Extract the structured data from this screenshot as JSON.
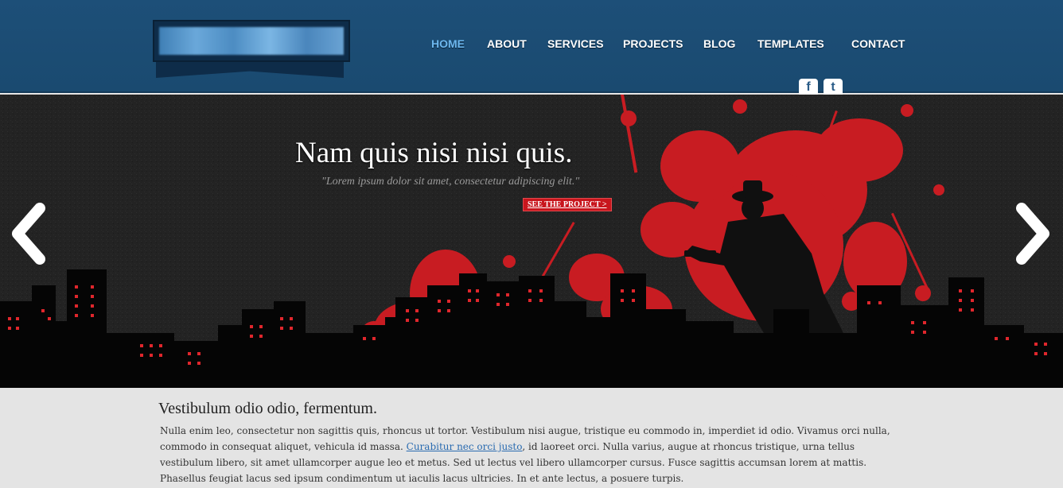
{
  "nav": {
    "items": [
      {
        "label": "HOME",
        "active": true
      },
      {
        "label": "ABOUT",
        "active": false
      },
      {
        "label": "SERVICES",
        "active": false
      },
      {
        "label": "PROJECTS",
        "active": false
      },
      {
        "label": "BLOG",
        "active": false
      },
      {
        "label": "TEMPLATES",
        "active": false
      },
      {
        "label": "CONTACT",
        "active": false
      }
    ]
  },
  "social": {
    "facebook_glyph": "f",
    "twitter_glyph": "t"
  },
  "hero": {
    "title": "Nam quis nisi nisi quis.",
    "subtitle": "\"Lorem ipsum dolor sit amet, consectetur adipiscing elit.\"",
    "button_label": "SEE THE PROJECT >"
  },
  "content": {
    "heading": "Vestibulum odio odio, fermentum.",
    "para_before": "Nulla enim leo, consectetur non sagittis quis, rhoncus ut tortor. Vestibulum nisi augue, tristique eu commodo in, imperdiet id odio. Vivamus orci nulla, commodo in consequat aliquet, vehicula id massa. ",
    "link": "Curabitur nec orci justo",
    "para_after": ", id laoreet orci. Nulla varius, augue at rhoncus tristique, urna tellus vestibulum libero, sit amet ullamcorper augue leo et metus. Sed ut lectus vel libero ullamcorper cursus. Fusce sagittis accumsan lorem at mattis. Phasellus feugiat lacus sed ipsum condimentum ut iaculis lacus ultricies. In et ante lectus, a posuere turpis."
  },
  "colors": {
    "header_bg": "#1d4f78",
    "nav_active": "#6db7ee",
    "accent_red": "#c8161d",
    "hero_bg": "#222222",
    "content_bg": "#e4e4e4"
  }
}
